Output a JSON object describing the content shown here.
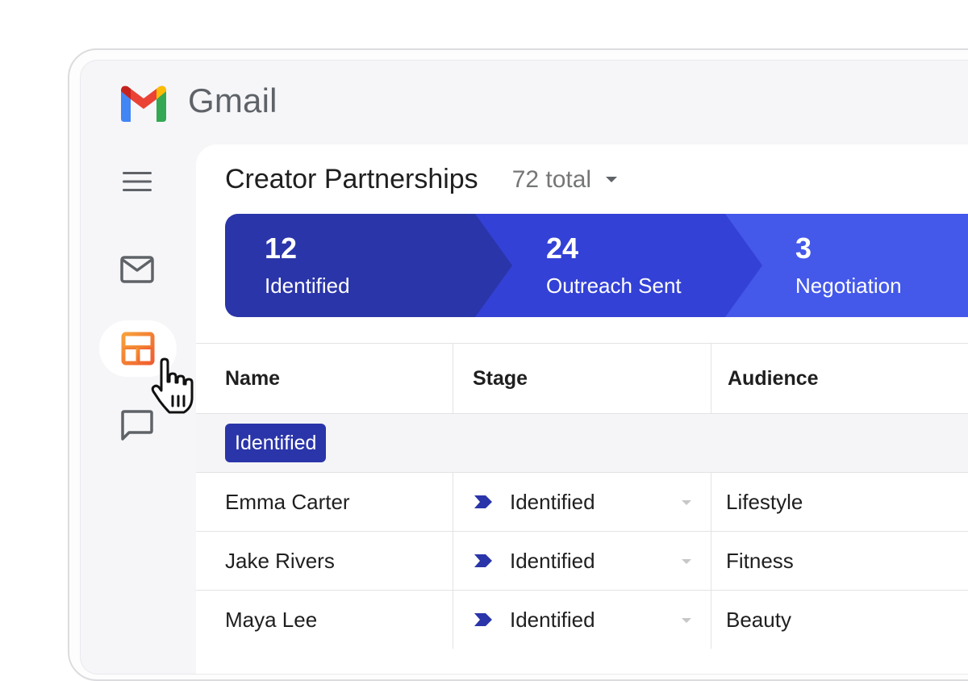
{
  "app": {
    "name": "Gmail"
  },
  "colors": {
    "accent_dark": "#2a35a9",
    "accent_mid": "#3341d6",
    "accent_light": "#4458ea",
    "layout_icon": "#f4862b"
  },
  "rail": {
    "icons": [
      "menu-icon",
      "mail-icon",
      "layout-icon",
      "chat-icon"
    ]
  },
  "view": {
    "title": "Creator Partnerships",
    "total_label": "72 total"
  },
  "pipeline": [
    {
      "count": "12",
      "label": "Identified"
    },
    {
      "count": "24",
      "label": "Outreach Sent"
    },
    {
      "count": "3",
      "label": "Negotiation"
    }
  ],
  "table": {
    "columns": [
      "Name",
      "Stage",
      "Audience"
    ],
    "group": "Identified",
    "rows": [
      {
        "name": "Emma Carter",
        "stage": "Identified",
        "audience": "Lifestyle"
      },
      {
        "name": "Jake Rivers",
        "stage": "Identified",
        "audience": "Fitness"
      },
      {
        "name": "Maya Lee",
        "stage": "Identified",
        "audience": "Beauty"
      }
    ]
  }
}
